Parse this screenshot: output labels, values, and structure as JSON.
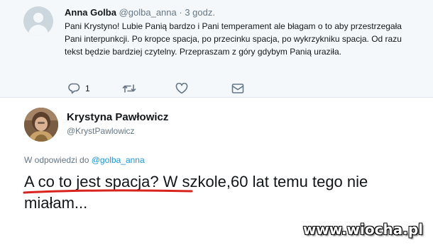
{
  "reply_tweet": {
    "name": "Anna Golba",
    "handle": "@golba_anna",
    "separator": "·",
    "time": "3 godz.",
    "text": "Pani Krystyno! Lubie Panią bardzo i Pani temperament ale błagam o to aby przestrzegała Pani interpunkcji. Po kropce spacja, po przecinku spacja, po wykrzykniku spacja. Od razu tekst będzie bardziej czytelny. Przepraszam z góry gdybym Panią uraziła.",
    "reply_count": "1",
    "icons": [
      "reply-icon",
      "retweet-icon",
      "like-icon",
      "dm-icon"
    ]
  },
  "main_tweet": {
    "name": "Krystyna Pawłowicz",
    "handle": "@KrystPawlowicz",
    "reply_context_prefix": "W odpowiedzi do",
    "reply_context_mention": "@golba_anna",
    "text": "A co to jest spacja? W szkole,60 lat temu tego nie miałam...",
    "underline_color": "#d8231f"
  },
  "watermark": "www.wiocha.pl",
  "colors": {
    "text": "#14171a",
    "muted": "#657786",
    "link": "#1b95e0",
    "reply_bg": "#f5f8fa"
  }
}
